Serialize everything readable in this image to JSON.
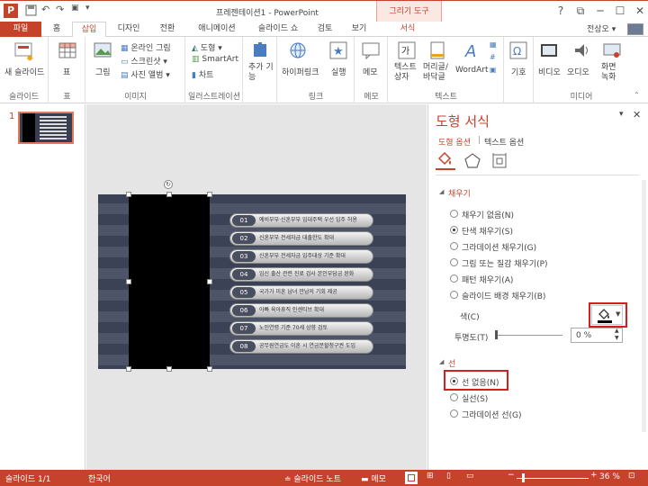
{
  "titlebar": {
    "title": "프레젠테이션1 - PowerPoint",
    "tool_tab": "그리기 도구",
    "logo": "P",
    "qat_icons": [
      "save-icon",
      "undo-icon",
      "redo-icon",
      "present-icon",
      "customize-icon"
    ],
    "window_buttons": [
      "?",
      "⧉",
      "─",
      "☐",
      "✕"
    ]
  },
  "tabs": [
    {
      "label": "파일"
    },
    {
      "label": "홈"
    },
    {
      "label": "삽입"
    },
    {
      "label": "디자인"
    },
    {
      "label": "전환"
    },
    {
      "label": "애니메이션"
    },
    {
      "label": "슬라이드 쇼"
    },
    {
      "label": "검토"
    },
    {
      "label": "보기"
    },
    {
      "label": "서식"
    }
  ],
  "user": "전상오 ▾",
  "ribbon": {
    "groups": [
      {
        "label": "슬라이드",
        "items": [
          "새 슬라이드"
        ]
      },
      {
        "label": "표",
        "items": [
          "표"
        ]
      },
      {
        "label": "이미지",
        "items": [
          "그림",
          "온라인 그림",
          "스크린샷 ▾",
          "사진 앨범 ▾"
        ]
      },
      {
        "label": "일러스트레이션",
        "items": [
          "도형 ▾",
          "SmartArt",
          "차트"
        ]
      },
      {
        "label": "",
        "items": [
          "추가 기능"
        ]
      },
      {
        "label": "링크",
        "items": [
          "하이퍼링크",
          "실행"
        ]
      },
      {
        "label": "메모",
        "items": [
          "메모"
        ]
      },
      {
        "label": "텍스트",
        "items": [
          "텍스트 상자",
          "머리글/ 바닥글",
          "WordArt"
        ]
      },
      {
        "label": "",
        "items": [
          "기호"
        ]
      },
      {
        "label": "미디어",
        "items": [
          "비디오",
          "오디오",
          "화면 녹화"
        ]
      }
    ]
  },
  "slide_panel": {
    "number": "1"
  },
  "slide": {
    "items": [
      {
        "num": "01",
        "text": "예비부부·신혼부부 임대주택 우선 입주 허용"
      },
      {
        "num": "02",
        "text": "신혼부부 전세자금 대출한도 확대"
      },
      {
        "num": "03",
        "text": "신혼부부 전세자금 입주대상 기준 확대"
      },
      {
        "num": "04",
        "text": "임신 출산 관련 진료 검사 본인부담금 완화"
      },
      {
        "num": "05",
        "text": "국가가 미혼 남녀 만남의 기회 제공"
      },
      {
        "num": "06",
        "text": "아빠 육아휴직 인센티브 확대"
      },
      {
        "num": "07",
        "text": "노인연령 기준 70세 상향 검토"
      },
      {
        "num": "08",
        "text": "공무원연금도 이혼 시 연금분할청구권 도입"
      }
    ]
  },
  "format_pane": {
    "title": "도형 서식",
    "tabs": [
      "도형 옵션",
      "텍스트 옵션"
    ],
    "tab_separator": "|",
    "fill_section": "채우기",
    "fill_options": [
      {
        "label": "채우기 없음(N)",
        "selected": false
      },
      {
        "label": "단색 채우기(S)",
        "selected": true
      },
      {
        "label": "그라데이션 채우기(G)",
        "selected": false
      },
      {
        "label": "그림 또는 질감 채우기(P)",
        "selected": false
      },
      {
        "label": "패턴 채우기(A)",
        "selected": false
      },
      {
        "label": "슬라이드 배경 채우기(B)",
        "selected": false
      }
    ],
    "color_label": "색(C)",
    "transparency_label": "투명도(T)",
    "transparency_value": "0 %",
    "line_section": "선",
    "line_options": [
      {
        "label": "선 없음(N)",
        "selected": true
      },
      {
        "label": "실선(S)",
        "selected": false
      },
      {
        "label": "그라데이션 선(G)",
        "selected": false
      }
    ]
  },
  "status": {
    "slide": "슬라이드 1/1",
    "language": "한국어",
    "notes": "슬라이드 노트",
    "comments": "메모",
    "zoom": "36 %"
  },
  "colors": {
    "accent": "#c5432b",
    "highlight": "#d21f1f"
  }
}
